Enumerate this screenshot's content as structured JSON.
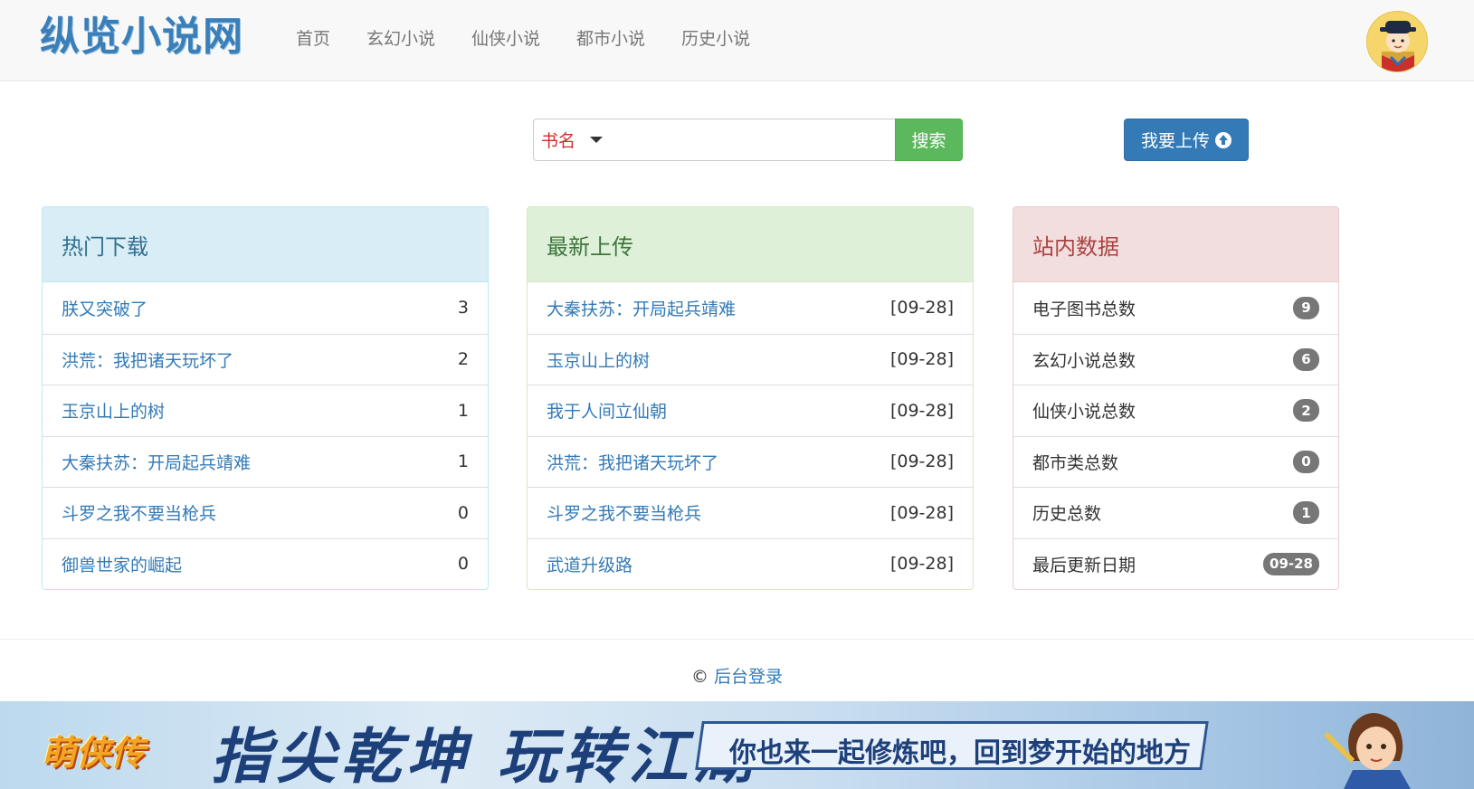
{
  "brand": "纵览小说网",
  "nav": {
    "links": [
      "首页",
      "玄幻小说",
      "仙侠小说",
      "都市小说",
      "历史小说"
    ]
  },
  "search": {
    "select_label": "书名",
    "input_value": "",
    "button_label": "搜索"
  },
  "upload": {
    "label": "我要上传"
  },
  "hot": {
    "title": "热门下载",
    "items": [
      {
        "name": "朕又突破了",
        "count": "3"
      },
      {
        "name": "洪荒：我把诸天玩坏了",
        "count": "2"
      },
      {
        "name": "玉京山上的树",
        "count": "1"
      },
      {
        "name": "大秦扶苏：开局起兵靖难",
        "count": "1"
      },
      {
        "name": "斗罗之我不要当枪兵",
        "count": "0"
      },
      {
        "name": "御兽世家的崛起",
        "count": "0"
      }
    ]
  },
  "latest": {
    "title": "最新上传",
    "items": [
      {
        "name": "大秦扶苏：开局起兵靖难",
        "date": "[09-28]"
      },
      {
        "name": "玉京山上的树",
        "date": "[09-28]"
      },
      {
        "name": "我于人间立仙朝",
        "date": "[09-28]"
      },
      {
        "name": "洪荒：我把诸天玩坏了",
        "date": "[09-28]"
      },
      {
        "name": "斗罗之我不要当枪兵",
        "date": "[09-28]"
      },
      {
        "name": "武道升级路",
        "date": "[09-28]"
      }
    ]
  },
  "stats": {
    "title": "站内数据",
    "items": [
      {
        "label": "电子图书总数",
        "value": "9"
      },
      {
        "label": "玄幻小说总数",
        "value": "6"
      },
      {
        "label": "仙侠小说总数",
        "value": "2"
      },
      {
        "label": "都市类总数",
        "value": "0"
      },
      {
        "label": "历史总数",
        "value": "1"
      },
      {
        "label": "最后更新日期",
        "value": "09-28"
      }
    ]
  },
  "footer": {
    "copyright": "©",
    "admin_link": "后台登录"
  },
  "banner": {
    "logo": "萌侠传",
    "slogan": "指尖乾坤 玩转江湖",
    "tagline": "你也来一起修炼吧，回到梦开始的地方"
  },
  "colors": {
    "brand": "#3a7fb8",
    "link": "#337ab7",
    "search_button": "#5cb85c",
    "upload_button": "#337ab7",
    "info_heading": "#d9edf7",
    "success_heading": "#dff0d8",
    "danger_heading": "#f2dede",
    "badge": "#777777"
  },
  "icons": {
    "upload": "circle-arrow-up-icon",
    "select": "caret-down-icon",
    "avatar": "avatar-portrait"
  }
}
